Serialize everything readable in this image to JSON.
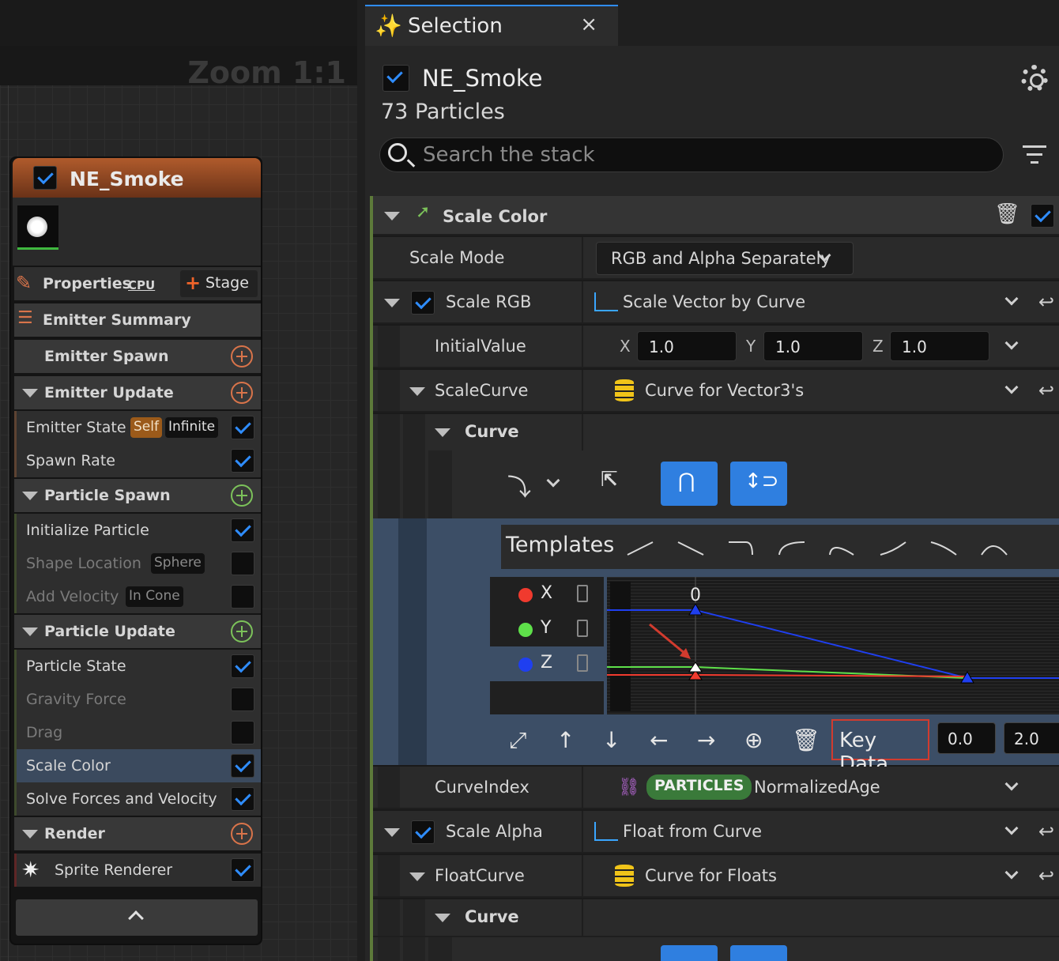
{
  "graph": {
    "zoom_label": "Zoom 1:1"
  },
  "emitter": {
    "name": "NE_Smoke",
    "enabled": true,
    "properties_label": "Properties",
    "cpu_label": "CPU",
    "stage_label": "Stage",
    "summary_label": "Emitter Summary",
    "sections": {
      "emitter_spawn": "Emitter Spawn",
      "emitter_update": "Emitter Update",
      "particle_spawn": "Particle Spawn",
      "particle_update": "Particle Update",
      "render": "Render"
    },
    "items": {
      "emitter_state": {
        "label": "Emitter State",
        "tag1": "Self",
        "tag2": "Infinite",
        "enabled": true
      },
      "spawn_rate": {
        "label": "Spawn Rate",
        "enabled": true
      },
      "initialize_particle": {
        "label": "Initialize Particle",
        "enabled": true
      },
      "shape_location": {
        "label": "Shape Location",
        "tag": "Sphere",
        "enabled": false
      },
      "add_velocity": {
        "label": "Add Velocity",
        "tag": "In Cone",
        "enabled": false
      },
      "particle_state": {
        "label": "Particle State",
        "enabled": true
      },
      "gravity_force": {
        "label": "Gravity Force",
        "enabled": false
      },
      "drag": {
        "label": "Drag",
        "enabled": false
      },
      "scale_color": {
        "label": "Scale Color",
        "enabled": true
      },
      "solve_forces": {
        "label": "Solve Forces and Velocity",
        "enabled": true
      },
      "sprite_renderer": {
        "label": "Sprite Renderer",
        "enabled": true
      }
    }
  },
  "selection": {
    "tab_title": "Selection",
    "close_glyph": "×",
    "emitter_name": "NE_Smoke",
    "particle_count": "73 Particles",
    "search_placeholder": "Search the stack",
    "module": {
      "title": "Scale Color",
      "scale_mode_label": "Scale Mode",
      "scale_mode_value": "RGB and Alpha Separately",
      "scale_rgb_label": "Scale RGB",
      "scale_rgb_value": "Scale Vector by Curve",
      "initial_value_label": "InitialValue",
      "x_label": "X",
      "y_label": "Y",
      "z_label": "Z",
      "x_value": "1.0",
      "y_value": "1.0",
      "z_value": "1.0",
      "scale_curve_label": "ScaleCurve",
      "scale_curve_value": "Curve for Vector3's",
      "curve_label": "Curve",
      "templates_label": "Templates",
      "channels": [
        "X",
        "Y",
        "Z"
      ],
      "channel_colors": [
        "#f03a2e",
        "#5ee04a",
        "#1f3ff0"
      ],
      "graph_top_label": "0",
      "key_data_label": "Key Data",
      "key_time": "0.0",
      "key_value": "2.0",
      "curve_index_label": "CurveIndex",
      "particles_tag": "PARTICLES",
      "curve_index_value": "NormalizedAge",
      "scale_alpha_label": "Scale Alpha",
      "scale_alpha_value": "Float from Curve",
      "float_curve_label": "FloatCurve",
      "float_curve_value": "Curve for Floats",
      "curve2_label": "Curve"
    }
  }
}
